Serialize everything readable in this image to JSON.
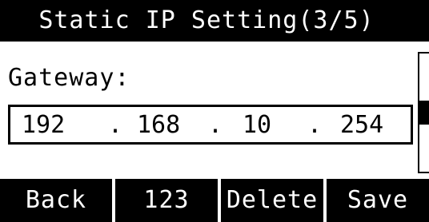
{
  "screen": {
    "title": "Static IP Setting(3/5)"
  },
  "field": {
    "label": "Gateway:",
    "ip_octets": [
      "192",
      "168",
      "10",
      "254"
    ],
    "separator": "."
  },
  "scrollbar": {
    "page": 3,
    "total_pages": 5
  },
  "softkeys": [
    "Back",
    "123",
    "Delete",
    "Save"
  ],
  "colors": {
    "background": "#ffffff",
    "bars": "#000000",
    "bar_text": "#ffffff"
  }
}
